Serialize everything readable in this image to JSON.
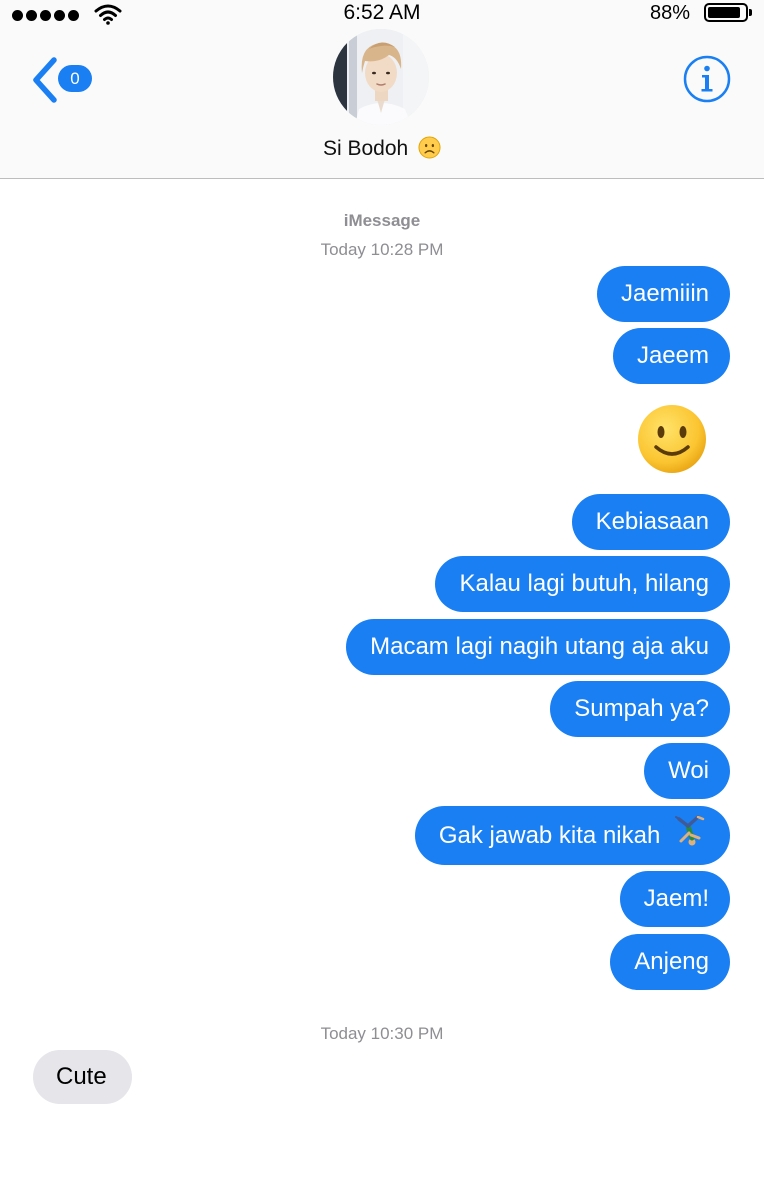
{
  "status_bar": {
    "time": "6:52 AM",
    "battery_percent": "88%",
    "battery_level": 0.88,
    "signal_dots": 5
  },
  "header": {
    "back_badge_count": "0",
    "contact_name": "Si Bodoh",
    "name_emoji": "frowning-face",
    "info_icon": "info-icon"
  },
  "conversation": {
    "service": "iMessage",
    "timestamp_1": "Today 10:28 PM",
    "timestamp_2": "Today 10:30 PM",
    "sent_messages": [
      "Jaemiiin",
      "Jaeem",
      "Kebiasaan",
      "Kalau lagi butuh, hilang",
      "Macam lagi nagih utang aja aku",
      "Sumpah ya?",
      "Woi",
      "Gak jawab kita nikah",
      "Jaem!",
      "Anjeng"
    ],
    "emoji_message": "slightly-smiling-face",
    "inline_emoji": "person-cartwheeling",
    "received_messages": [
      "Cute"
    ]
  },
  "colors": {
    "sent_bubble": "#1a7ff2",
    "received_bubble": "#e5e5ea",
    "accent": "#1a7ff2",
    "timestamp": "#8e8e93"
  }
}
